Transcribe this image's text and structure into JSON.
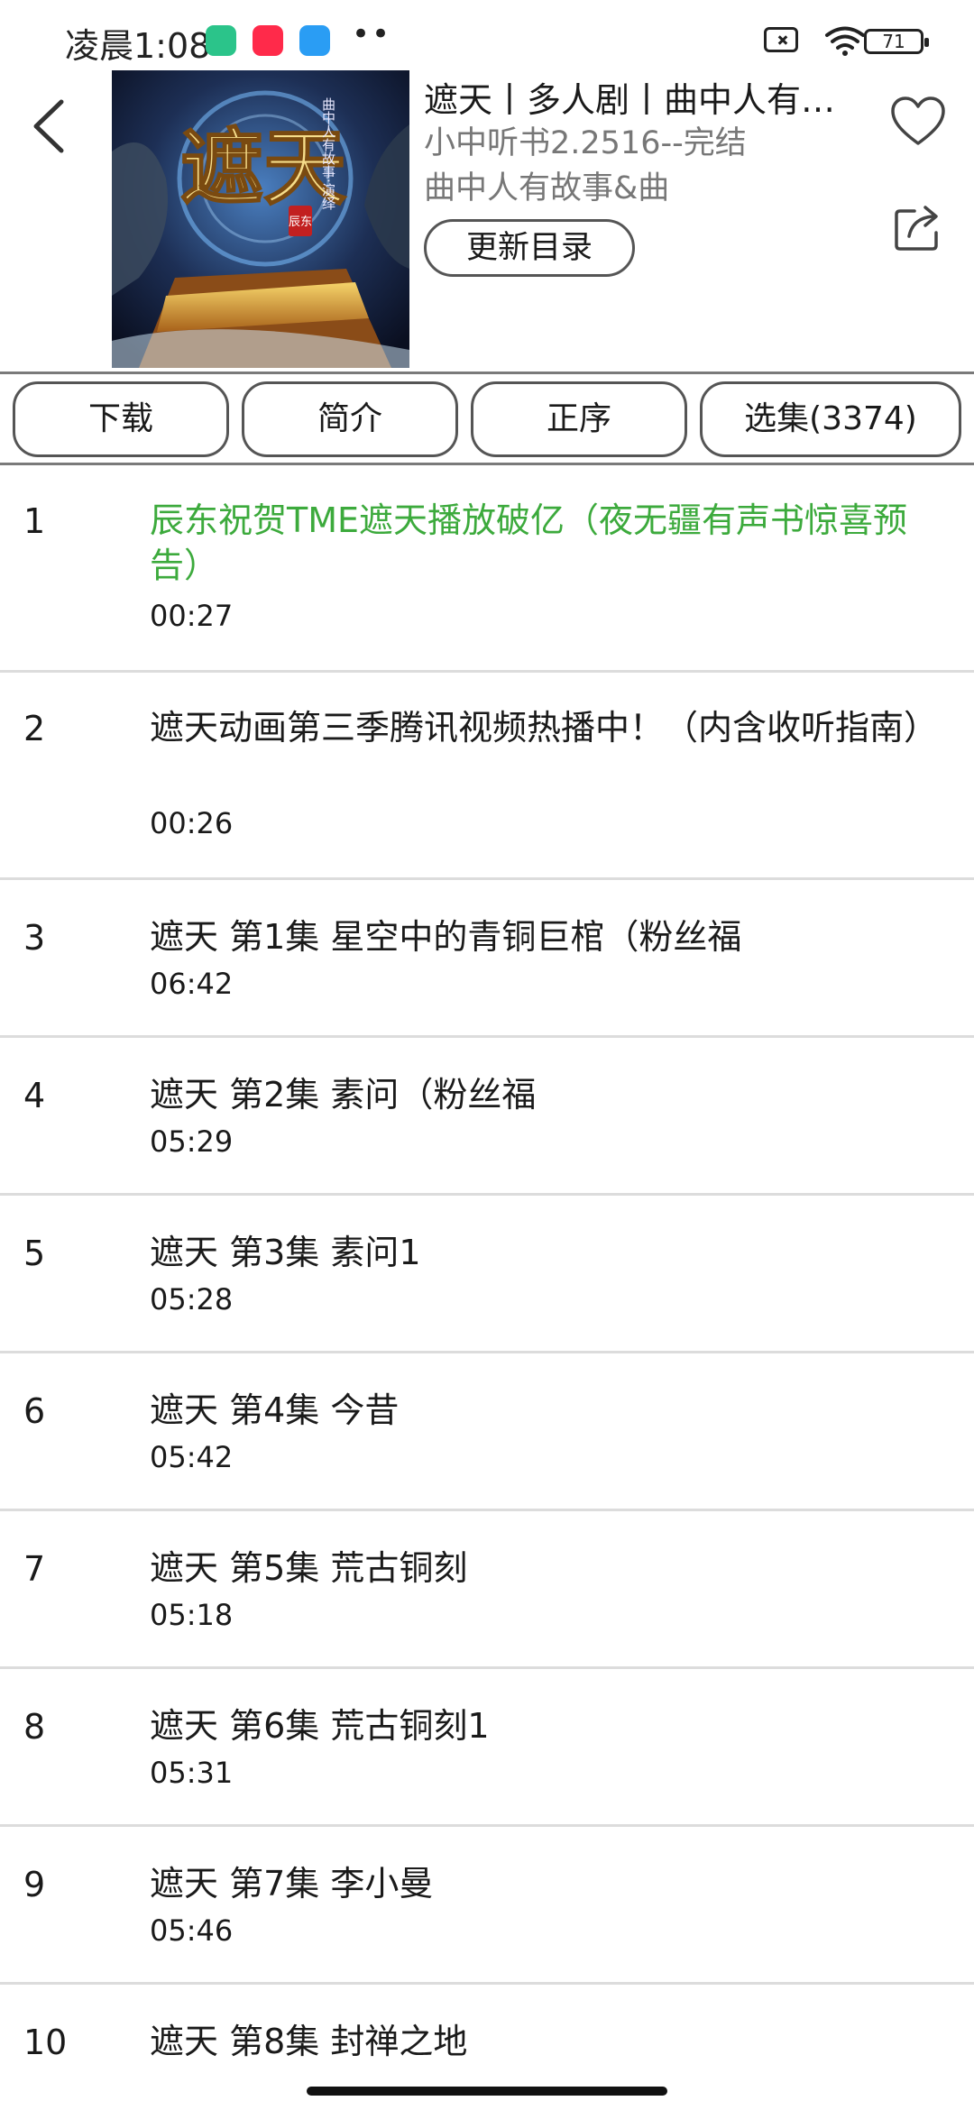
{
  "status": {
    "time": "凌晨1:08",
    "dots": "••",
    "battery": "71",
    "app_icons": [
      "app-green-icon",
      "xiaohongshu-icon",
      "app-blue-icon"
    ]
  },
  "header": {
    "title": "遮天丨多人剧丨曲中人有…",
    "subtitle_author": "小中听书2.2516--完结",
    "subtitle_anchor": "曲中人有故事&曲",
    "update_label": "更新目录",
    "cover_text": {
      "main": "遮天",
      "side": "曲中人有故事·演绎",
      "seal": "辰东"
    }
  },
  "tabs": [
    {
      "label": "下载"
    },
    {
      "label": "简介"
    },
    {
      "label": "正序"
    },
    {
      "label": "选集(3374)"
    }
  ],
  "episodes": [
    {
      "num": "1",
      "title": "辰东祝贺TME遮天播放破亿（夜无疆有声书惊喜预告）",
      "duration": "00:27",
      "playing": true
    },
    {
      "num": "2",
      "title": "遮天动画第三季腾讯视频热播中！（内含收听指南）",
      "duration": "00:26"
    },
    {
      "num": "3",
      "title": "遮天 第1集 星空中的青铜巨棺（粉丝福",
      "duration": "06:42"
    },
    {
      "num": "4",
      "title": "遮天 第2集 素问（粉丝福",
      "duration": "05:29"
    },
    {
      "num": "5",
      "title": "遮天 第3集 素问1",
      "duration": "05:28"
    },
    {
      "num": "6",
      "title": "遮天 第4集 今昔",
      "duration": "05:42"
    },
    {
      "num": "7",
      "title": "遮天 第5集 荒古铜刻",
      "duration": "05:18"
    },
    {
      "num": "8",
      "title": "遮天 第6集 荒古铜刻1",
      "duration": "05:31"
    },
    {
      "num": "9",
      "title": "遮天 第7集 李小曼",
      "duration": "05:46"
    },
    {
      "num": "10",
      "title": "遮天 第8集 封禅之地",
      "duration": ""
    }
  ],
  "colors": {
    "playing": "#3caa3c",
    "text": "#1a1a1a",
    "muted": "#777777",
    "divider": "#dcdcdc"
  }
}
